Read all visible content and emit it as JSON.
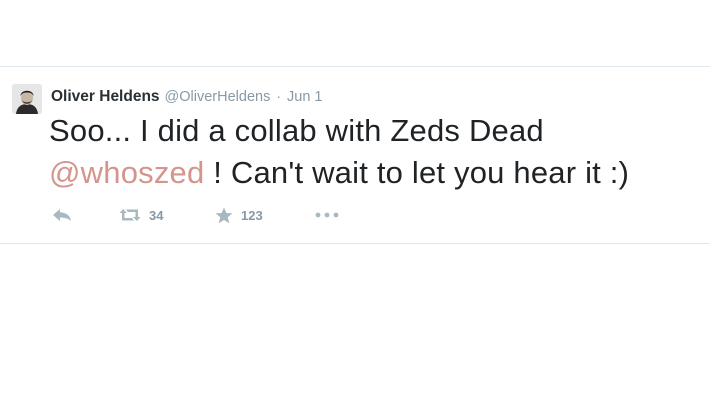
{
  "tweet": {
    "author": {
      "fullname": "Oliver Heldens",
      "username": "@OliverHeldens",
      "avatar_icon": "avatar-portrait"
    },
    "separator": "·",
    "timestamp": "Jun 1",
    "text_part1": "Soo... I did a collab with Zeds Dead",
    "mention": "@whoszed",
    "text_part2": " ! Can't wait to let you hear it :)",
    "actions": {
      "reply_icon": "reply-icon",
      "retweet_icon": "retweet-icon",
      "retweet_count": "34",
      "favorite_icon": "star-icon",
      "favorite_count": "123",
      "more_icon": "more-dots-icon"
    },
    "colors": {
      "mention": "#d4958c",
      "muted": "#8899a6",
      "icon": "#aab8c2",
      "text": "#1f2326",
      "border": "#e1e8ed"
    }
  }
}
